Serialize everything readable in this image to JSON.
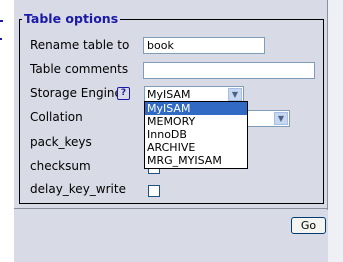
{
  "table_options": {
    "legend": "Table options",
    "rename_label": "Rename table to",
    "rename_value": "book",
    "comments_label": "Table comments",
    "comments_value": "",
    "storage_engine_label": "Storage Engine",
    "help_icon": "?",
    "storage_engine_value": "MyISAM",
    "storage_engine_options": [
      "MyISAM",
      "MEMORY",
      "InnoDB",
      "ARCHIVE",
      "MRG_MYISAM"
    ],
    "collation_label": "Collation",
    "collation_value": "",
    "pack_keys_label": "pack_keys",
    "checksum_label": "checksum",
    "delay_key_write_label": "delay_key_write",
    "delay_key_write_checked": false
  },
  "footer": {
    "go_label": "Go"
  },
  "colors": {
    "legend": "#1a1aa6",
    "panel": "#d8dbe6",
    "selected_option": "#316ac5"
  }
}
